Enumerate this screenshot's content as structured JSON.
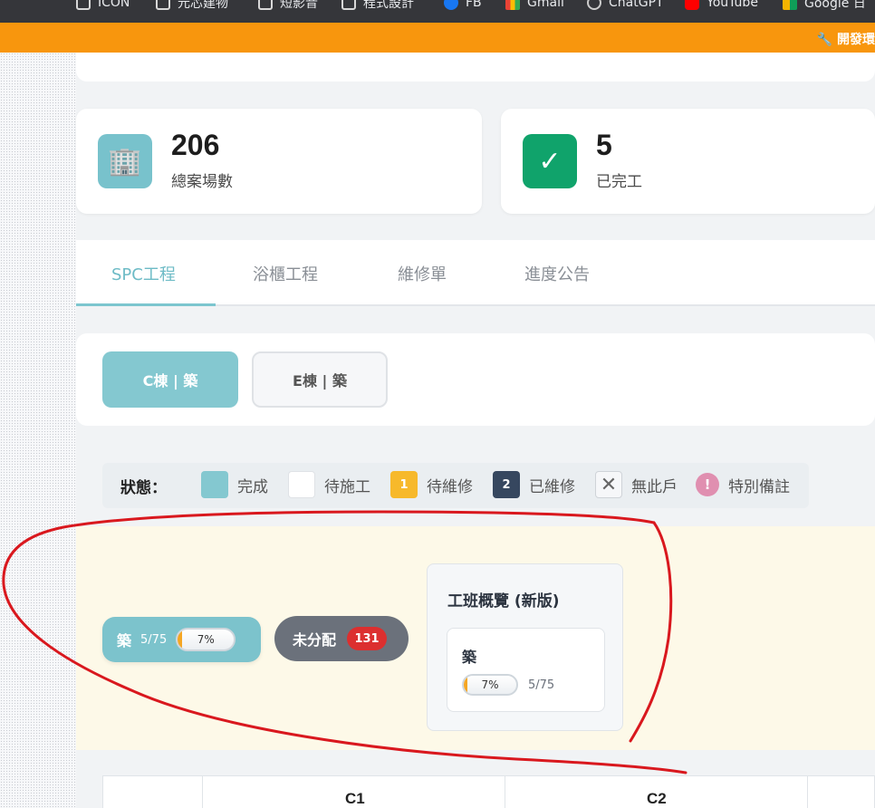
{
  "browser": {
    "bookmarks": [
      {
        "label": "ICON",
        "icon": "folder-icon"
      },
      {
        "label": "元芯建物",
        "icon": "folder-icon"
      },
      {
        "label": "短影音",
        "icon": "folder-icon"
      },
      {
        "label": "程式設計",
        "icon": "folder-icon"
      },
      {
        "label": "FB",
        "icon": "facebook-icon"
      },
      {
        "label": "Gmail",
        "icon": "gmail-icon"
      },
      {
        "label": "ChatGPT",
        "icon": "chatgpt-icon"
      },
      {
        "label": "YouTube",
        "icon": "youtube-icon"
      },
      {
        "label": "Google 日",
        "icon": "google-icon"
      }
    ]
  },
  "banner": {
    "text": "🔧 開發環",
    "color": "#f8960d"
  },
  "stats": [
    {
      "value": "206",
      "label": "總案場數",
      "icon": "building-icon",
      "icon_glyph": "🏢"
    },
    {
      "value": "5",
      "label": "已完工",
      "icon": "check-icon",
      "icon_glyph": "✓"
    }
  ],
  "tabs": [
    {
      "label": "SPC工程",
      "active": true
    },
    {
      "label": "浴櫃工程",
      "active": false
    },
    {
      "label": "維修單",
      "active": false
    },
    {
      "label": "進度公告",
      "active": false
    }
  ],
  "buildings": [
    {
      "label": "C棟 | 築",
      "active": true
    },
    {
      "label": "E棟 | 築",
      "active": false
    }
  ],
  "legend": {
    "title": "狀態：",
    "items": [
      {
        "label": "完成",
        "badge": ""
      },
      {
        "label": "待施工",
        "badge": ""
      },
      {
        "label": "待維修",
        "badge": "1"
      },
      {
        "label": "已維修",
        "badge": "2"
      },
      {
        "label": "無此戶",
        "badge": "✕"
      },
      {
        "label": "特別備註",
        "badge": "!"
      }
    ]
  },
  "crew": {
    "name": "築",
    "count": "5/75",
    "progress_label": "7%",
    "progress": 0.07,
    "unassigned_label": "未分配",
    "unassigned_count": "131"
  },
  "overview": {
    "title": "工班概覽 (新版)",
    "item_name": "築",
    "progress_label": "7%",
    "progress": 0.07,
    "count": "5/75"
  },
  "table": {
    "columns": [
      "",
      "C1",
      "C2"
    ]
  },
  "colors": {
    "accent": "#7cc6cf",
    "done": "#84c8d0",
    "to_repair": "#f7b92b",
    "repaired": "#36475f",
    "note": "#e08fb0",
    "unassigned_badge": "#dc2f2f",
    "annotation": "#d9181e"
  }
}
